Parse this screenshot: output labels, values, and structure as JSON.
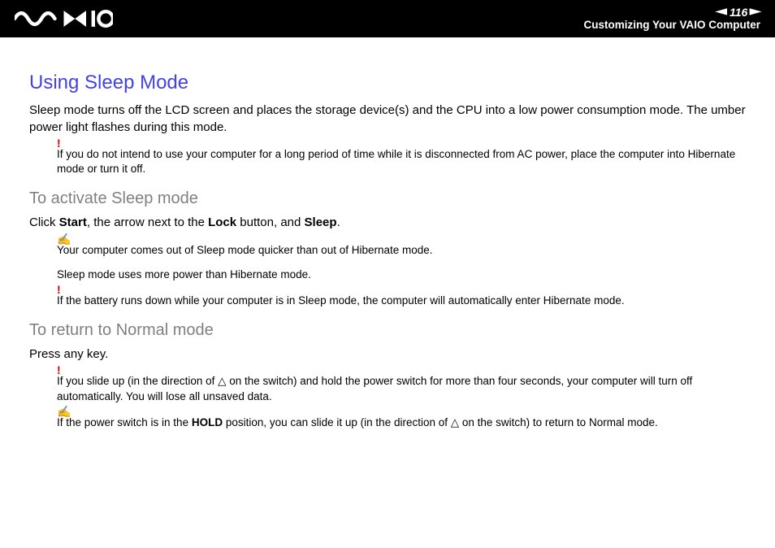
{
  "header": {
    "logo_alt": "VAIO",
    "page_number": "116",
    "breadcrumb": "Customizing Your VAIO Computer"
  },
  "content": {
    "title": "Using Sleep Mode",
    "intro": "Sleep mode turns off the LCD screen and places the storage device(s) and the CPU into a low power consumption mode. The umber power light flashes during this mode.",
    "warn1": "If you do not intend to use your computer for a long period of time while it is disconnected from AC power, place the computer into Hibernate mode or turn it off.",
    "h2_activate": "To activate Sleep mode",
    "activate_instr_pre": "Click ",
    "activate_b1": "Start",
    "activate_mid1": ", the arrow next to the ",
    "activate_b2": "Lock",
    "activate_mid2": " button, and ",
    "activate_b3": "Sleep",
    "activate_end": ".",
    "tip1_line1": "Your computer comes out of Sleep mode quicker than out of Hibernate mode.",
    "tip1_line2": "Sleep mode uses more power than Hibernate mode.",
    "warn2": "If the battery runs down while your computer is in Sleep mode, the computer will automatically enter Hibernate mode.",
    "h2_return": "To return to Normal mode",
    "return_instr": "Press any key.",
    "warn3": "If you slide up (in the direction of △ on the switch) and hold the power switch for more than four seconds, your computer will turn off automatically. You will lose all unsaved data.",
    "tip2_pre": "If the power switch is in the ",
    "tip2_b": "HOLD",
    "tip2_post": " position, you can slide it up (in the direction of △ on the switch) to return to Normal mode."
  }
}
